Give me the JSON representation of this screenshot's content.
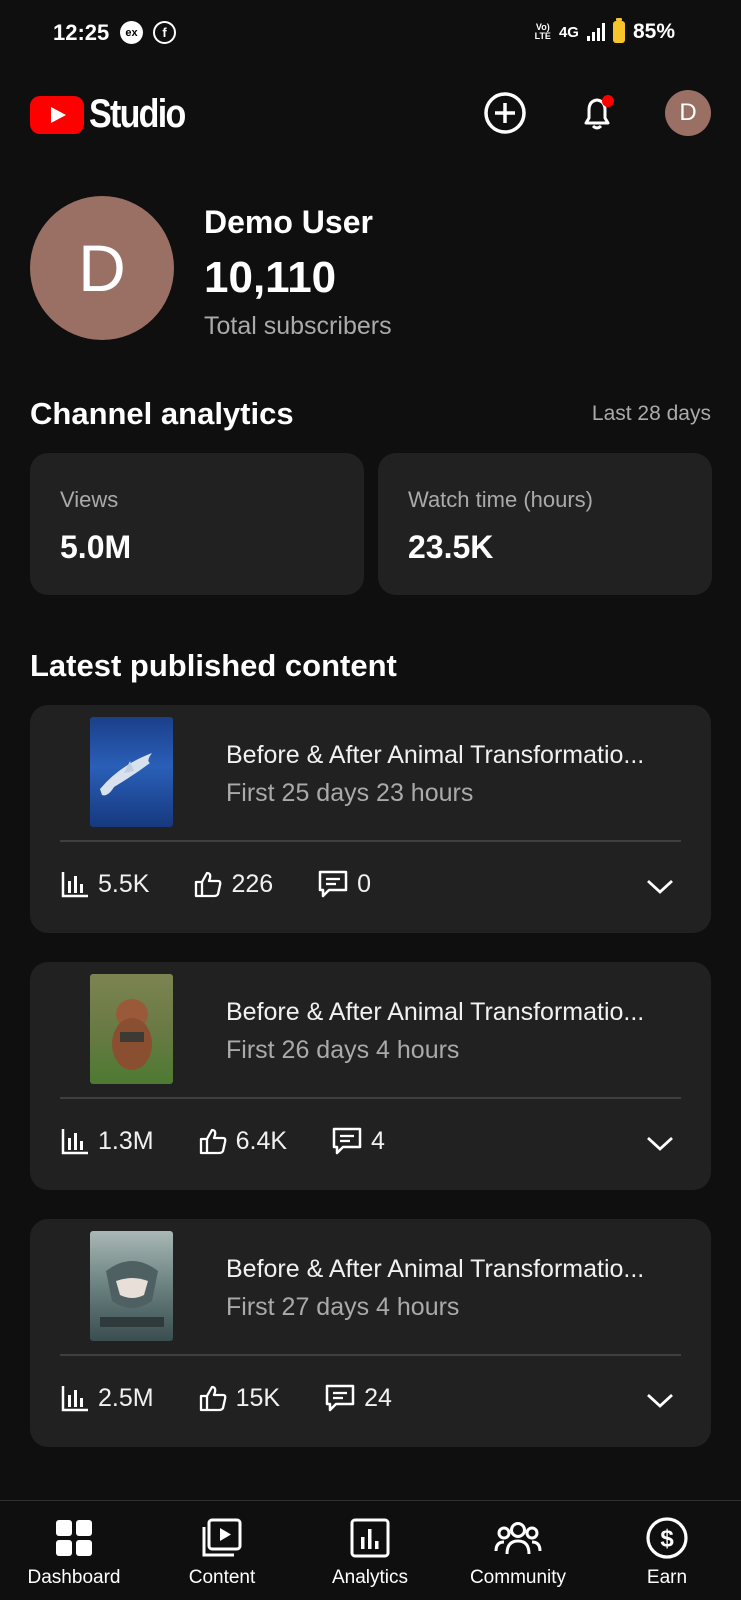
{
  "status_bar": {
    "time": "12:25",
    "left_icons": [
      "ex-icon",
      "facebook-icon"
    ],
    "volte": "Vo) LTE",
    "network": "4G",
    "battery": "85%"
  },
  "header": {
    "logo_text": "Studio",
    "brand_color": "#ff0000"
  },
  "channel": {
    "avatar_initial": "D",
    "name": "Demo User",
    "subscribers": "10,110",
    "subscribers_label": "Total subscribers"
  },
  "analytics": {
    "title": "Channel analytics",
    "period": "Last 28 days",
    "cards": [
      {
        "label": "Views",
        "value": "5.0M"
      },
      {
        "label": "Watch time (hours)",
        "value": "23.5K"
      }
    ]
  },
  "latest": {
    "title": "Latest published content",
    "videos": [
      {
        "title": "Before & After Animal Transformatio...",
        "subtitle": "First 25 days 23 hours",
        "views": "5.5K",
        "likes": "226",
        "comments": "0"
      },
      {
        "title": "Before & After Animal Transformatio...",
        "subtitle": "First 26 days 4 hours",
        "views": "1.3M",
        "likes": "6.4K",
        "comments": "4"
      },
      {
        "title": "Before & After Animal Transformatio...",
        "subtitle": "First 27 days 4 hours",
        "views": "2.5M",
        "likes": "15K",
        "comments": "24"
      }
    ]
  },
  "nav": {
    "items": [
      {
        "label": "Dashboard",
        "icon": "dashboard-icon"
      },
      {
        "label": "Content",
        "icon": "content-icon"
      },
      {
        "label": "Analytics",
        "icon": "analytics-icon"
      },
      {
        "label": "Community",
        "icon": "community-icon"
      },
      {
        "label": "Earn",
        "icon": "earn-icon"
      }
    ]
  }
}
